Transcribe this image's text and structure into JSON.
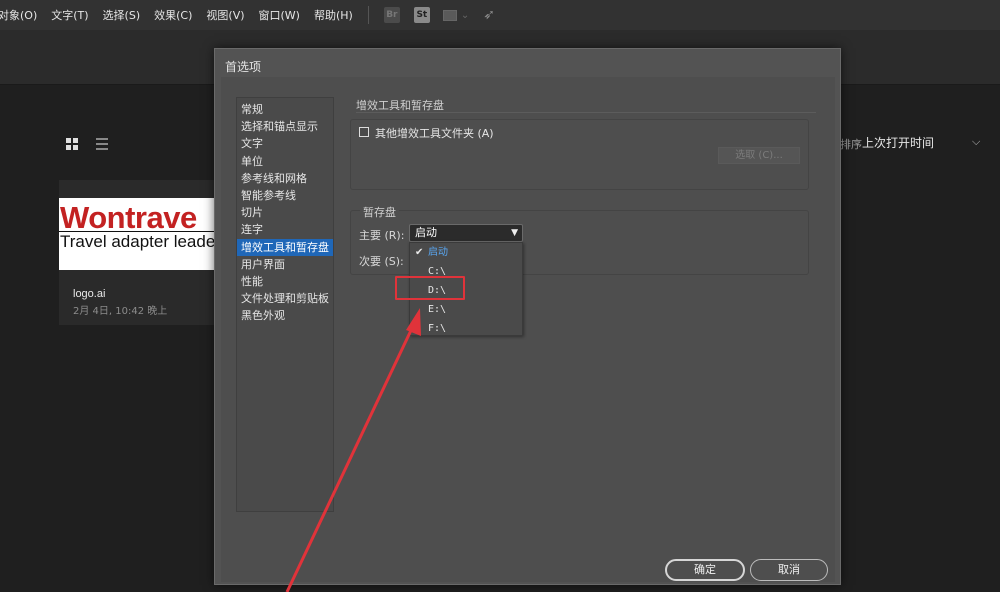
{
  "menubar": {
    "items": [
      "对象(O)",
      "文字(T)",
      "选择(S)",
      "效果(C)",
      "视图(V)",
      "窗口(W)",
      "帮助(H)"
    ],
    "app_icons": [
      {
        "name": "bridge-icon",
        "label": "Br"
      },
      {
        "name": "stock-icon",
        "label": "St"
      }
    ]
  },
  "home": {
    "sort_label": "排序",
    "sort_value": "上次打开时间",
    "recent_file": {
      "thumb_logo": "Wontrave",
      "thumb_tagline": "Travel adapter leade",
      "name": "logo.ai",
      "date": "2月 4日, 10:42 晚上"
    }
  },
  "dialog": {
    "title": "首选项",
    "categories": [
      "常规",
      "选择和锚点显示",
      "文字",
      "单位",
      "参考线和网格",
      "智能参考线",
      "切片",
      "连字",
      "增效工具和暂存盘",
      "用户界面",
      "性能",
      "文件处理和剪贴板",
      "黑色外观"
    ],
    "active_category": "增效工具和暂存盘",
    "plugins_section": {
      "heading": "增效工具和暂存盘",
      "checkbox_label": "其他增效工具文件夹 (A)",
      "choose_button": "选取 (C)..."
    },
    "scratch_section": {
      "heading": "暂存盘",
      "primary_label": "主要 (R):",
      "secondary_label": "次要 (S):",
      "primary_value": "启动",
      "options": [
        "启动",
        "C:\\",
        "D:\\",
        "E:\\",
        "F:\\"
      ],
      "selected_option": "启动"
    },
    "ok_button": "确定",
    "cancel_button": "取消"
  },
  "colors": {
    "accent": "#1f67b8",
    "annotation": "#e0333a",
    "logo_red": "#c32222"
  }
}
